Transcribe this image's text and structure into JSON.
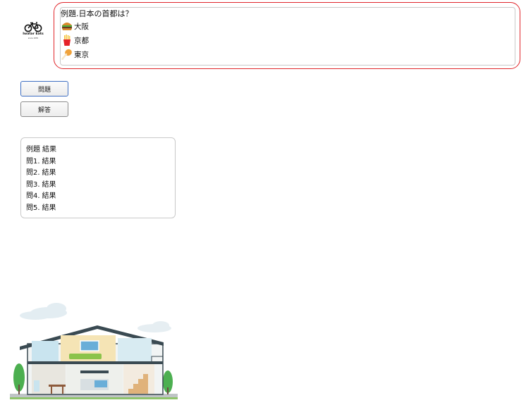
{
  "logo": {
    "name": "Iwatar Eats",
    "since": "since 1976"
  },
  "quiz": {
    "question": "例題.日本の首都は？",
    "options": [
      {
        "label": "大阪",
        "icon": "hamburger-icon"
      },
      {
        "label": "京都",
        "icon": "french-fries-icon"
      },
      {
        "label": "東京",
        "icon": "fried-chicken-icon"
      }
    ]
  },
  "buttons": {
    "question_label": "問題",
    "answer_label": "解答"
  },
  "results": {
    "lines": [
      {
        "label": "例題",
        "value": "結果"
      },
      {
        "label": "問1.",
        "value": "結果"
      },
      {
        "label": "問2.",
        "value": "結果"
      },
      {
        "label": "問3.",
        "value": "結果"
      },
      {
        "label": "問4.",
        "value": "結果"
      },
      {
        "label": "問5.",
        "value": "結果"
      }
    ]
  },
  "colors": {
    "quiz_border": "#e0262b",
    "question_button_border": "#3f6fc2"
  }
}
